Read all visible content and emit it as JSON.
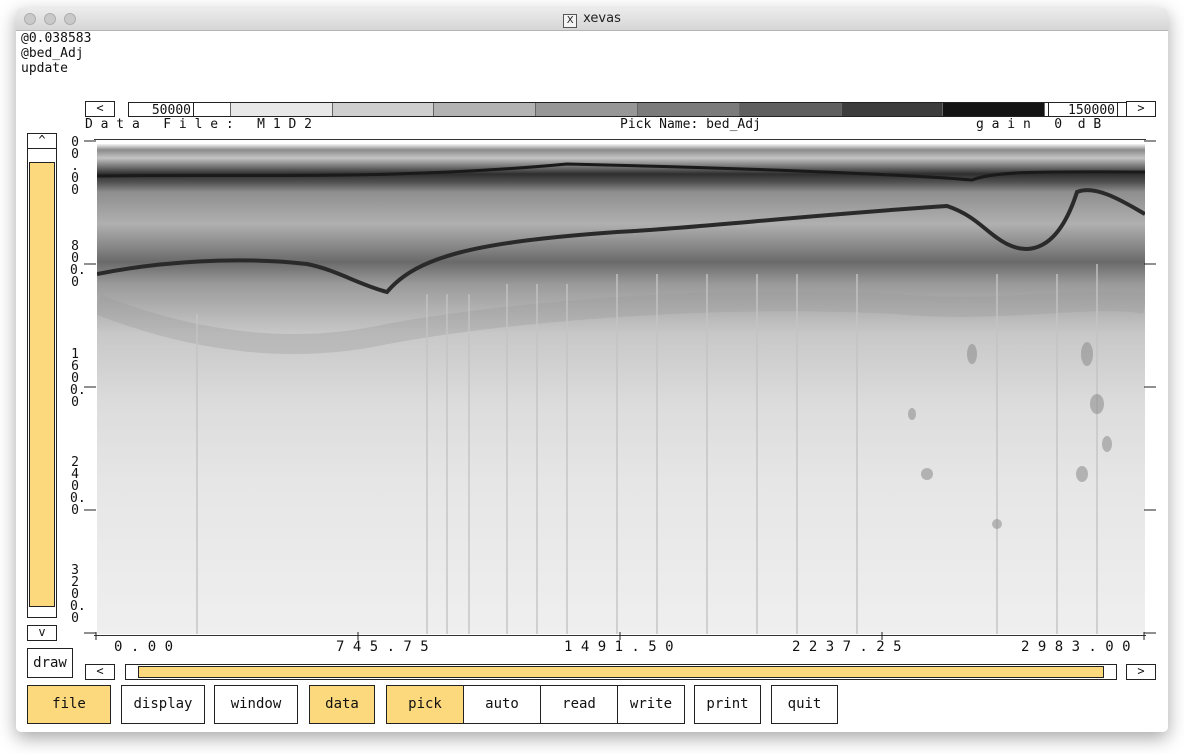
{
  "window": {
    "title": "xevas"
  },
  "status": {
    "lines": [
      "@0.038583",
      "@bed_Adj",
      "update"
    ]
  },
  "colorbar": {
    "left_arrow": "<",
    "right_arrow": ">",
    "min": "50000",
    "max": "150000"
  },
  "info": {
    "data_file": "D a t a   F i l e :   M 1 D 2",
    "pick_name": "Pick Name: bed_Adj",
    "gain": "g a i n   0  d B"
  },
  "yaxis": {
    "labels": [
      {
        "text": "0"
      },
      {
        "text": "800.0"
      },
      {
        "text": "1600.0"
      },
      {
        "text": "2400.0"
      },
      {
        "text": "3200.0"
      }
    ],
    "top_label": "0\n.\n0\n0"
  },
  "vscroll": {
    "up_arrow": "^",
    "down_arrow": "v",
    "draw_label": "draw"
  },
  "xaxis": {
    "labels": [
      "0 . 0 0",
      "7 4 5 . 7 5",
      "1 4 9 1 . 5 0",
      "2 2 3 7 . 2 5",
      "2 9 8 3 . 0 0"
    ]
  },
  "hscroll": {
    "left_arrow": "<",
    "right_arrow": ">"
  },
  "toolbar": {
    "file": "file",
    "display": "display",
    "window": "window",
    "data": "data",
    "pick": "pick",
    "auto": "auto",
    "read": "read",
    "write": "write",
    "print": "print",
    "quit": "quit"
  },
  "colors": {
    "accent": "#fcd97c",
    "frame": "#222222"
  }
}
